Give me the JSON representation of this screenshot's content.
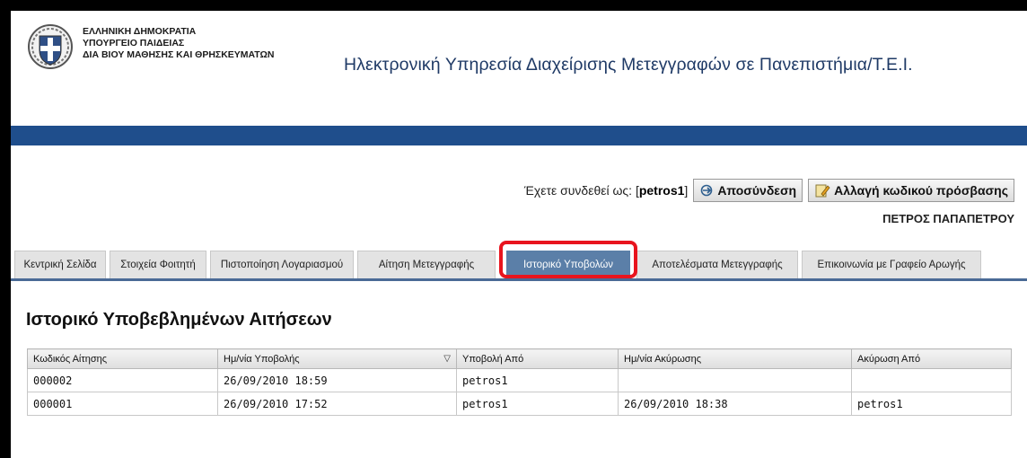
{
  "header": {
    "ministry_lines": [
      "ΕΛΛΗΝΙΚΗ ΔΗΜΟΚΡΑΤΙΑ",
      "ΥΠΟΥΡΓΕΙΟ ΠΑΙΔΕΙΑΣ",
      "ΔΙΑ ΒΙΟΥ ΜΑΘΗΣΗΣ ΚΑΙ ΘΡΗΣΚΕΥΜΑΤΩΝ"
    ],
    "site_title": "Ηλεκτρονική Υπηρεσία Διαχείρισης Μετεγγραφών σε Πανεπιστήμια/Τ.Ε.Ι.",
    "band_color": "#1f4e8c"
  },
  "user": {
    "logged_prefix": "Έχετε συνδεθεί ως: [",
    "username": "petros1",
    "logged_suffix": "]",
    "logout_label": "Αποσύνδεση",
    "change_password_label": "Αλλαγή κωδικού πρόσβασης",
    "full_name": "ΠΕΤΡΟΣ ΠΑΠΑΠΕΤΡΟΥ"
  },
  "tabs": [
    {
      "label": "Κεντρική Σελίδα"
    },
    {
      "label": "Στοιχεία Φοιτητή"
    },
    {
      "label": "Πιστοποίηση Λογαριασμού"
    },
    {
      "label": "Αίτηση Μετεγγραφής"
    },
    {
      "label": "Ιστορικό Υποβολών",
      "active": true
    },
    {
      "label": "Αποτελέσματα Μετεγγραφής"
    },
    {
      "label": "Επικοινωνία με Γραφείο Αρωγής"
    }
  ],
  "highlight_color": "#e8141e",
  "main": {
    "title": "Ιστορικό Υποβεβλημένων Αιτήσεων",
    "columns": [
      "Κωδικός Αίτησης",
      "Ημ/νία Υποβολής",
      "Υποβολή Από",
      "Ημ/νία Ακύρωσης",
      "Ακύρωση Από"
    ],
    "sort_indicator": "▽",
    "rows": [
      [
        "000002",
        "26/09/2010 18:59",
        "petros1",
        "",
        ""
      ],
      [
        "000001",
        "26/09/2010 17:52",
        "petros1",
        "26/09/2010 18:38",
        "petros1"
      ]
    ]
  }
}
